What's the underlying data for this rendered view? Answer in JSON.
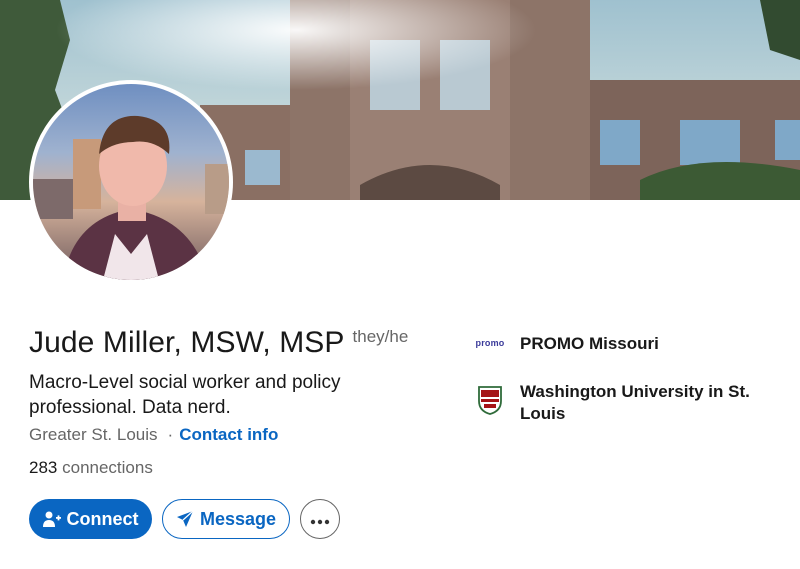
{
  "profile": {
    "name": "Jude Miller, MSW, MSP",
    "pronouns": "they/he",
    "headline": "Macro-Level social worker and policy professional. Data nerd.",
    "location": "Greater St. Louis",
    "separator": "·",
    "contact_label": "Contact info",
    "connections_count": "283",
    "connections_label": "connections"
  },
  "actions": {
    "connect_label": "Connect",
    "message_label": "Message",
    "more_icon": "ellipsis-icon"
  },
  "organizations": [
    {
      "logo_text": "promo",
      "name": "PROMO Missouri",
      "icon": "promo-logo"
    },
    {
      "name": "Washington University in St. Louis",
      "icon": "university-shield-logo"
    }
  ],
  "colors": {
    "primary": "#0a66c2",
    "text": "#191919",
    "muted": "#666666"
  }
}
